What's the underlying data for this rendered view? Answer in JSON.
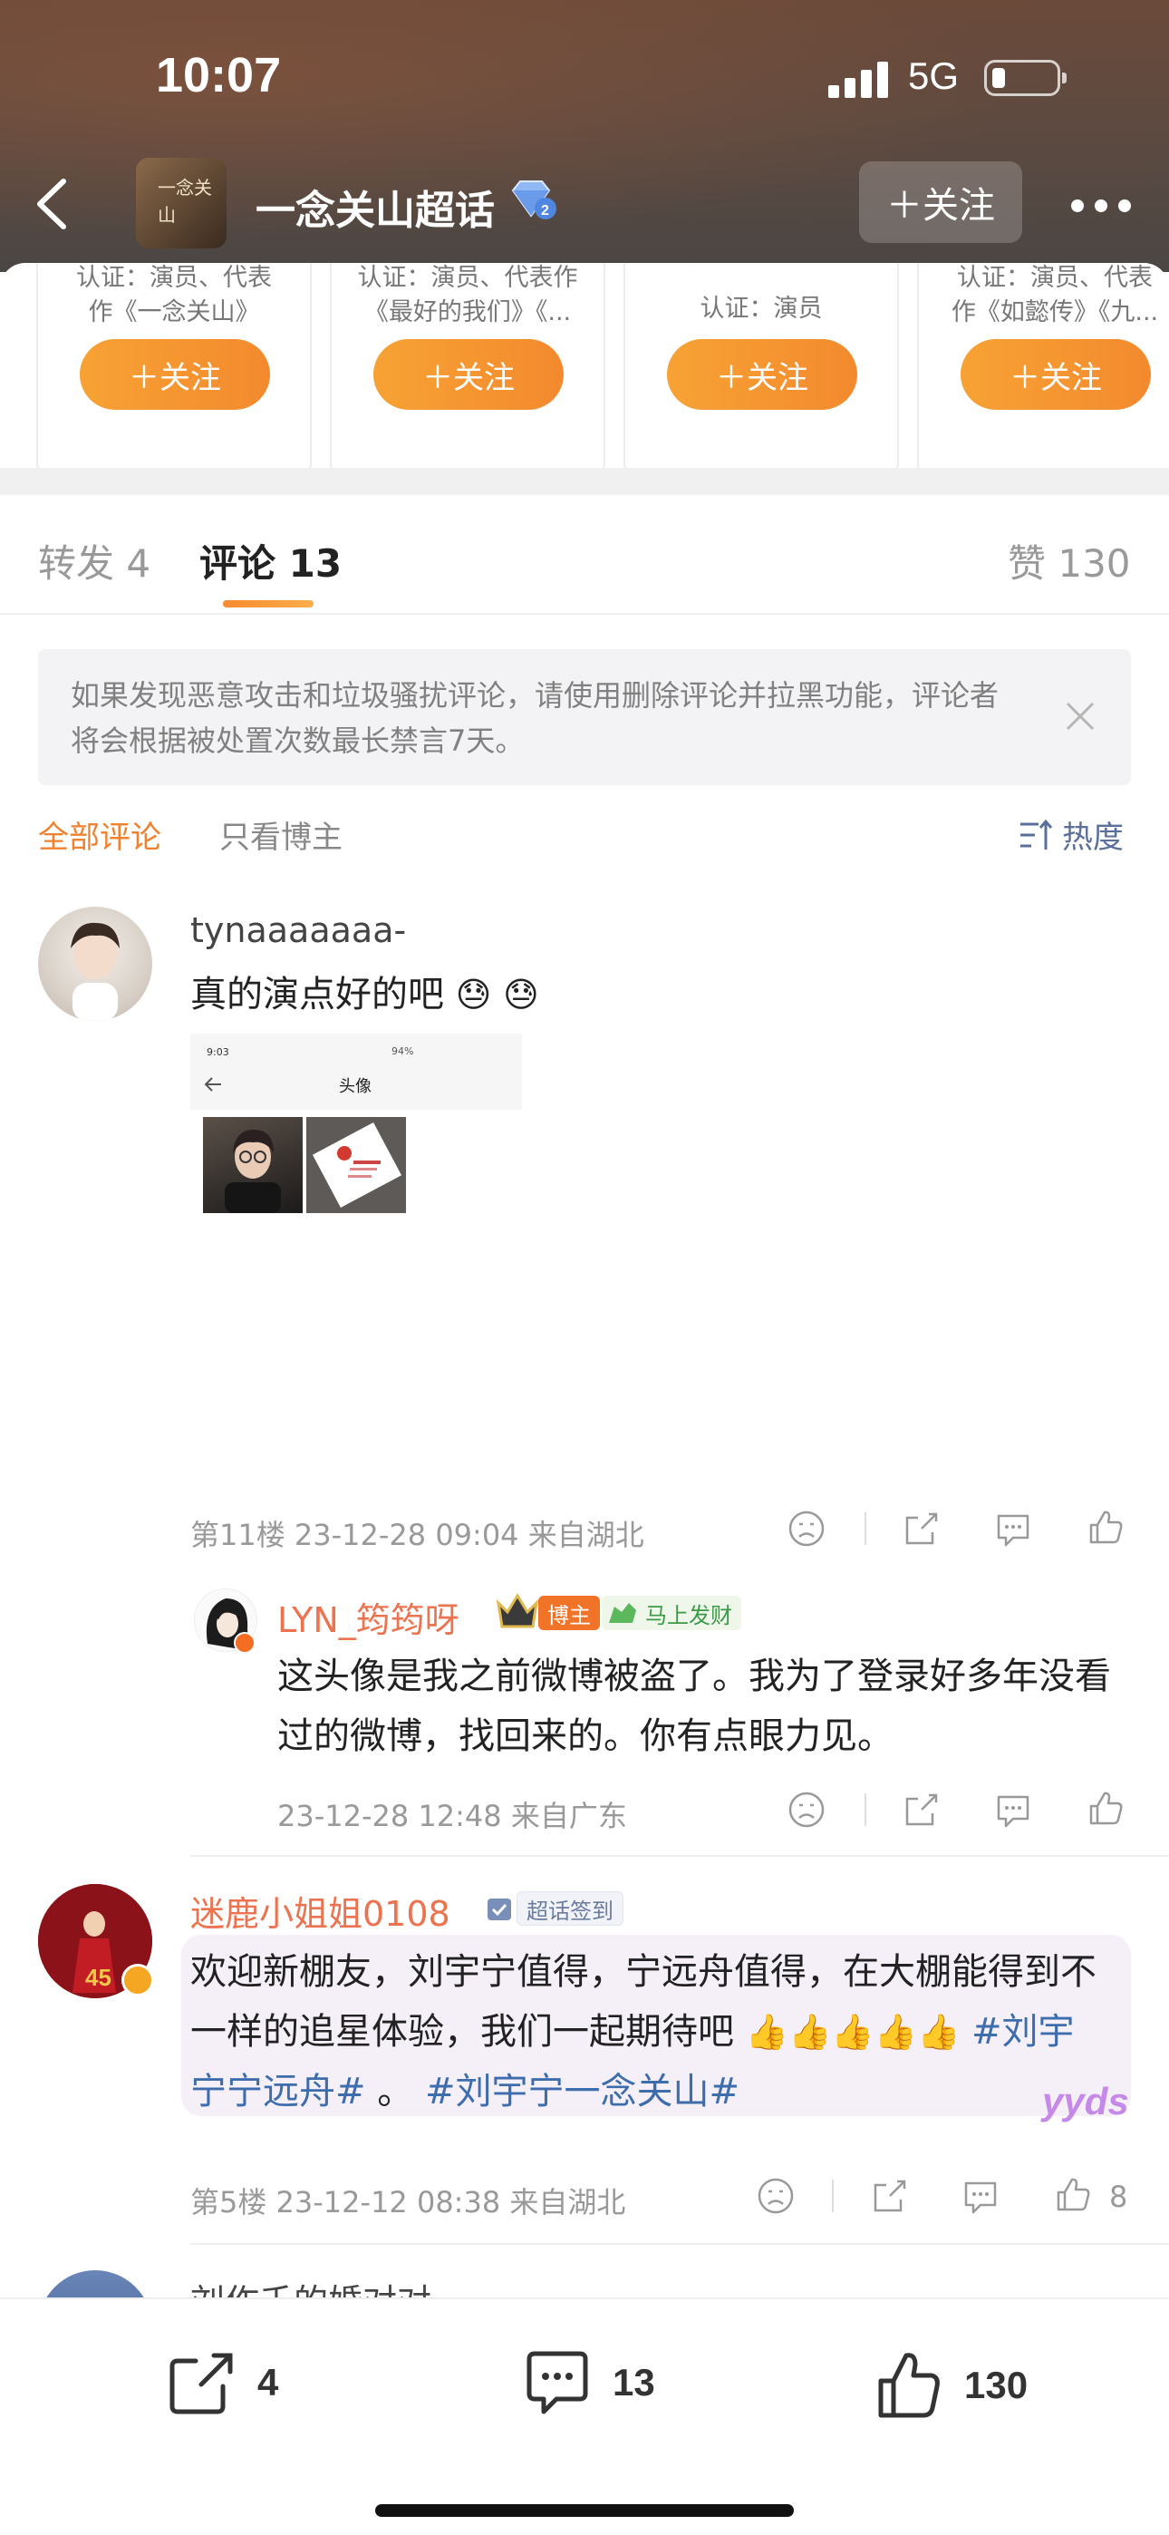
{
  "status_bar": {
    "time": "10:07",
    "network": "5G"
  },
  "header": {
    "title": "一念关山超话",
    "follow_label": "＋关注",
    "app_logo_text": "一念关山"
  },
  "recommend_cards": [
    {
      "desc_line1": "认证：演员、代表",
      "desc_line2": "作《一念关山》",
      "follow_label": "＋关注"
    },
    {
      "desc_line1": "认证：演员、代表作",
      "desc_line2": "《最好的我们》《...",
      "follow_label": "＋关注"
    },
    {
      "desc_line1": "认证：演员",
      "desc_line2": "",
      "follow_label": "＋关注"
    },
    {
      "desc_line1": "认证：演员、代表",
      "desc_line2": "作《如懿传》《九...",
      "follow_label": "＋关注"
    }
  ],
  "tabs": {
    "repost": "转发 4",
    "comment": "评论 13",
    "like": "赞 130"
  },
  "notice": {
    "text": "如果发现恶意攻击和垃圾骚扰评论，请使用删除评论并拉黑功能，评论者将会根据被处置次数最长禁言7天。"
  },
  "filters": {
    "all": "全部评论",
    "author_only": "只看博主",
    "sort": "热度"
  },
  "comments": [
    {
      "user": "tynaaaaaaa-",
      "text": "真的演点好的吧",
      "emoji": [
        "😓",
        "😓"
      ],
      "screenshot_time": "9:03",
      "screenshot_title": "头像",
      "screenshot_battery": "94%",
      "meta": "第11楼 23-12-28 09:04 来自湖北",
      "reply": {
        "user": "LYN_筠筠呀",
        "badge_author": "博主",
        "badge_fortune": "马上发财",
        "text": "这头像是我之前微博被盗了。我为了登录好多年没看过的微博，找回来的。你有点眼力见。",
        "meta": "23-12-28 12:48 来自广东"
      }
    },
    {
      "user": "迷鹿小姐姐0108",
      "badge_checkin": "超话签到",
      "text": "欢迎新棚友，刘宇宁值得，宁远舟值得，在大棚能得到不一样的追星体验，我们一起期待吧",
      "hashtag1": "#刘宇宁宁远舟#",
      "separator": "。",
      "hashtag2": "#刘宇宁一念关山#",
      "sticker": "yyds",
      "avatar_text": "45",
      "meta": "第5楼 23-12-12 08:38 来自湖北",
      "likes": "8"
    },
    {
      "user": "刘作千的婚对对"
    }
  ],
  "bottom_bar": {
    "repost_count": "4",
    "comment_count": "13",
    "like_count": "130"
  },
  "colors": {
    "accent_orange": "#f0812f",
    "link_blue": "#3e6dad",
    "name_orange": "#eb7350"
  }
}
